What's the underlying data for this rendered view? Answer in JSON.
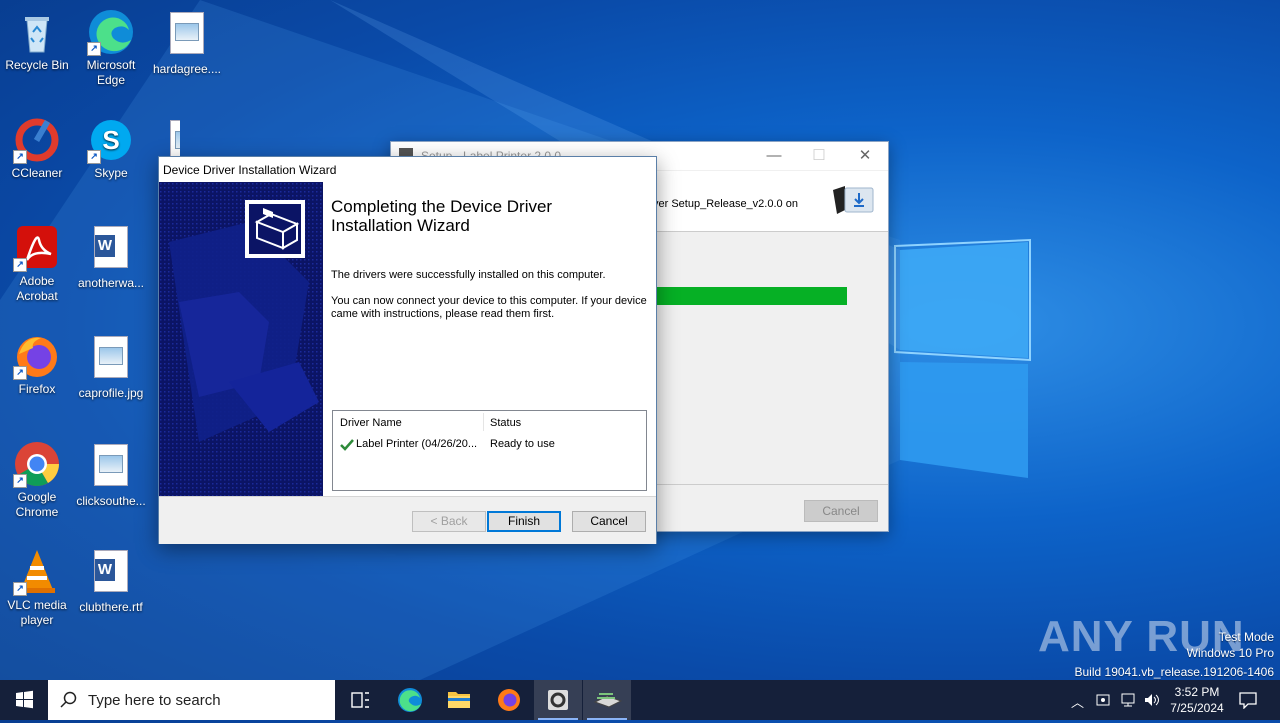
{
  "desktop_icons": [
    {
      "label": "Recycle Bin"
    },
    {
      "label": "Microsoft Edge"
    },
    {
      "label": "hardagree...."
    },
    {
      "label": "CCleaner"
    },
    {
      "label": "Skype"
    },
    {
      "label": "Adobe Acrobat"
    },
    {
      "label": "anotherwa..."
    },
    {
      "label": "Firefox"
    },
    {
      "label": "caprofile.jpg"
    },
    {
      "label": "Google Chrome"
    },
    {
      "label": "clicksouthe..."
    },
    {
      "label": "VLC media player"
    },
    {
      "label": "clubthere.rtf"
    }
  ],
  "setup_window": {
    "title": "Setup - Label Printer 2.0.0",
    "header_text": "ver Setup_Release_v2.0.0 on",
    "progress_fraction": 1.0,
    "cancel_label": "Cancel",
    "progress_color": "#06b025"
  },
  "wizard": {
    "title": "Device Driver Installation Wizard",
    "heading": "Completing the Device Driver Installation Wizard",
    "para1": "The drivers were successfully installed on this computer.",
    "para2": "You can now connect your device to this computer. If your device came with instructions, please read them first.",
    "columns": [
      "Driver Name",
      "Status"
    ],
    "rows": [
      {
        "name": "Label Printer  (04/26/20...",
        "status": "Ready to use"
      }
    ],
    "back_label": "< Back",
    "finish_label": "Finish",
    "cancel_label": "Cancel",
    "sidebar_color": "#0b1465"
  },
  "watermark": {
    "brand": "ANY RUN",
    "mode": "Test Mode",
    "edition": "Windows 10 Pro",
    "build": "Build 19041.vb_release.191206-1406"
  },
  "taskbar": {
    "search_placeholder": "Type here to search",
    "time": "3:52 PM",
    "date": "7/25/2024"
  }
}
